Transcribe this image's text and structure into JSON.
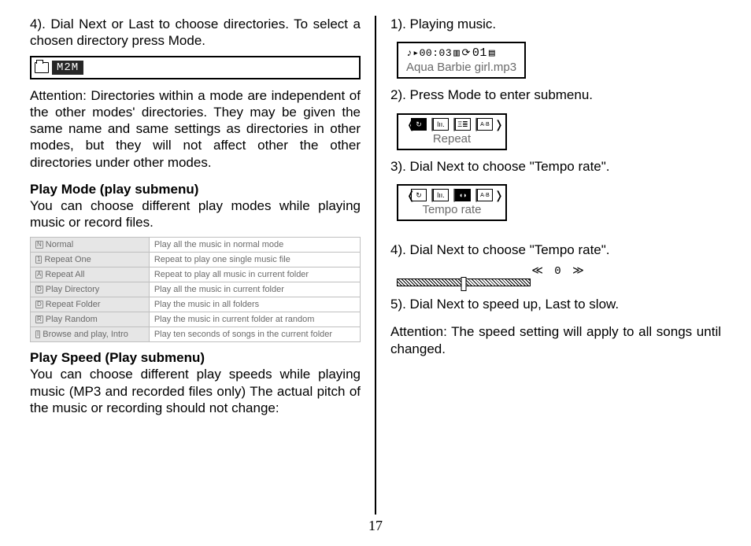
{
  "left": {
    "p4": "4). Dial Next or Last to choose directories. To select a chosen directory press Mode.",
    "m2m_label": "M2M",
    "attention": "Attention: Directories within a mode are independent of the other modes' directories. They may be given the same name and same settings as directories in other modes, but they will not affect other the other directories under other modes.",
    "playmode_heading": "Play Mode (play submenu)",
    "playmode_text": "You can choose different play modes while playing music or record files.",
    "table": [
      {
        "icon": "N",
        "mode": "Normal",
        "desc": "Play all the music in normal mode"
      },
      {
        "icon": "1",
        "mode": "Repeat One",
        "desc": "Repeat to play one single music file"
      },
      {
        "icon": "A",
        "mode": "Repeat All",
        "desc": "Repeat to play all music in current folder"
      },
      {
        "icon": "D",
        "mode": "Play Directory",
        "desc": "Play all the music in current folder"
      },
      {
        "icon": "D",
        "mode": "Repeat Folder",
        "desc": "Play the music in all folders"
      },
      {
        "icon": "R",
        "mode": "Play Random",
        "desc": "Play the music in current folder at random"
      },
      {
        "icon": "I",
        "mode": "Browse and play, Intro",
        "desc": "Play ten seconds of songs in the current folder"
      }
    ],
    "playspeed_heading": "Play Speed (Play submenu)",
    "playspeed_text": "You can choose different play speeds while playing music (MP3 and recorded files only) The actual pitch of the music or recording should not change:"
  },
  "right": {
    "s1_label": "1). Playing music.",
    "s1_time": "♪▸00:03",
    "s1_track": "01",
    "s1_file": "Aqua Barbie girl.mp3",
    "s2_label": "2). Press Mode to enter submenu.",
    "s2_text": "Repeat",
    "s3_label": "3). Dial Next to choose \"Tempo rate\".",
    "s3_text": "Tempo rate",
    "s4_label": "4). Dial Next to choose \"Tempo rate\".",
    "s4_val": "≪ 0 ≫",
    "s5_label": "5). Dial Next to speed up, Last to slow.",
    "attention": "Attention: The speed setting will apply to all songs until changed."
  },
  "page_number": "17"
}
